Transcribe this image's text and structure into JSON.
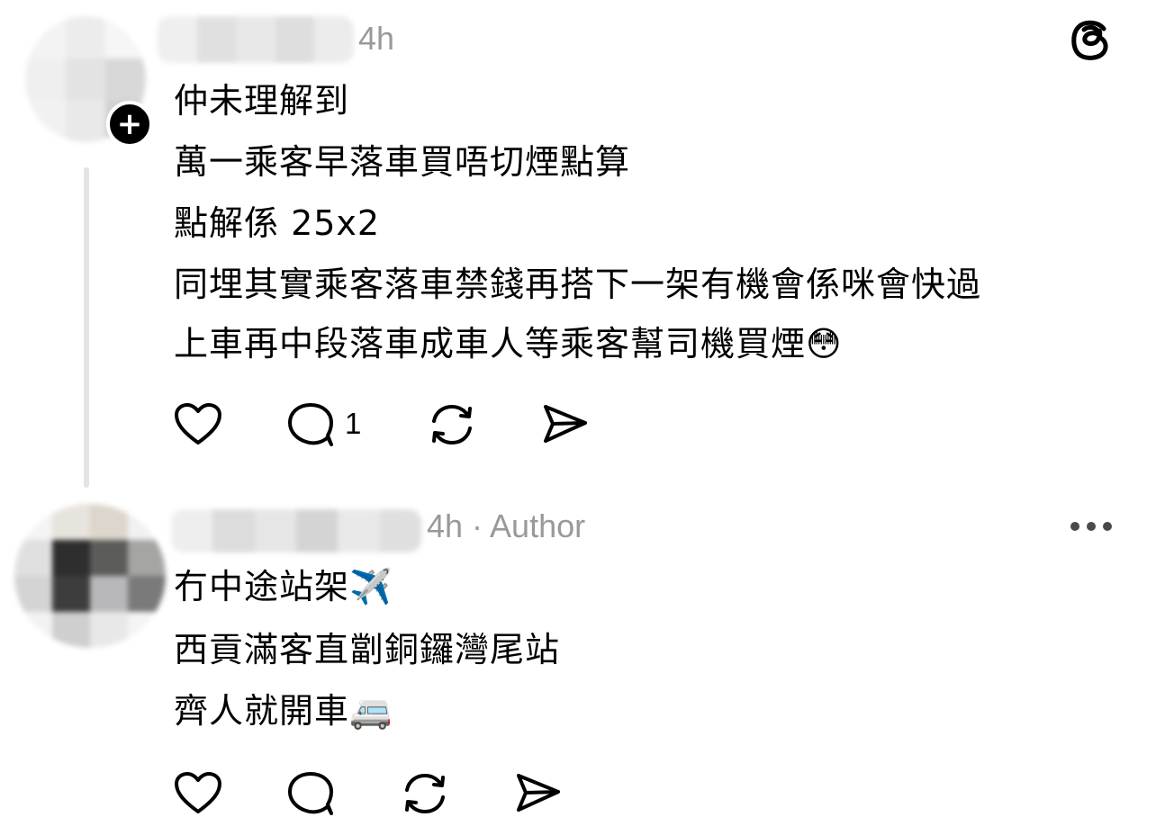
{
  "reply1": {
    "time": "4h",
    "lines": [
      "仲未理解到",
      "萬一乘客早落車買唔切煙點算",
      "點解係 25x2",
      "同埋其實乘客落車禁錢再搭下一架有機會係咪會快過",
      "上車再中段落車成車人等乘客幫司機買煙😳"
    ],
    "reply_count": "1",
    "follow_badge_icon": "plus-icon"
  },
  "reply2": {
    "time_author": "4h · Author",
    "lines": [
      "冇中途站架✈️",
      "西貢滿客直劏銅鑼灣尾站",
      "齊人就開車🚐"
    ]
  },
  "app": {
    "logo_icon": "threads-logo-icon"
  },
  "icons": {
    "like": "heart-icon",
    "comment": "comment-bubble-icon",
    "repost": "repost-icon",
    "share": "send-icon",
    "more": "more-dots-icon"
  }
}
